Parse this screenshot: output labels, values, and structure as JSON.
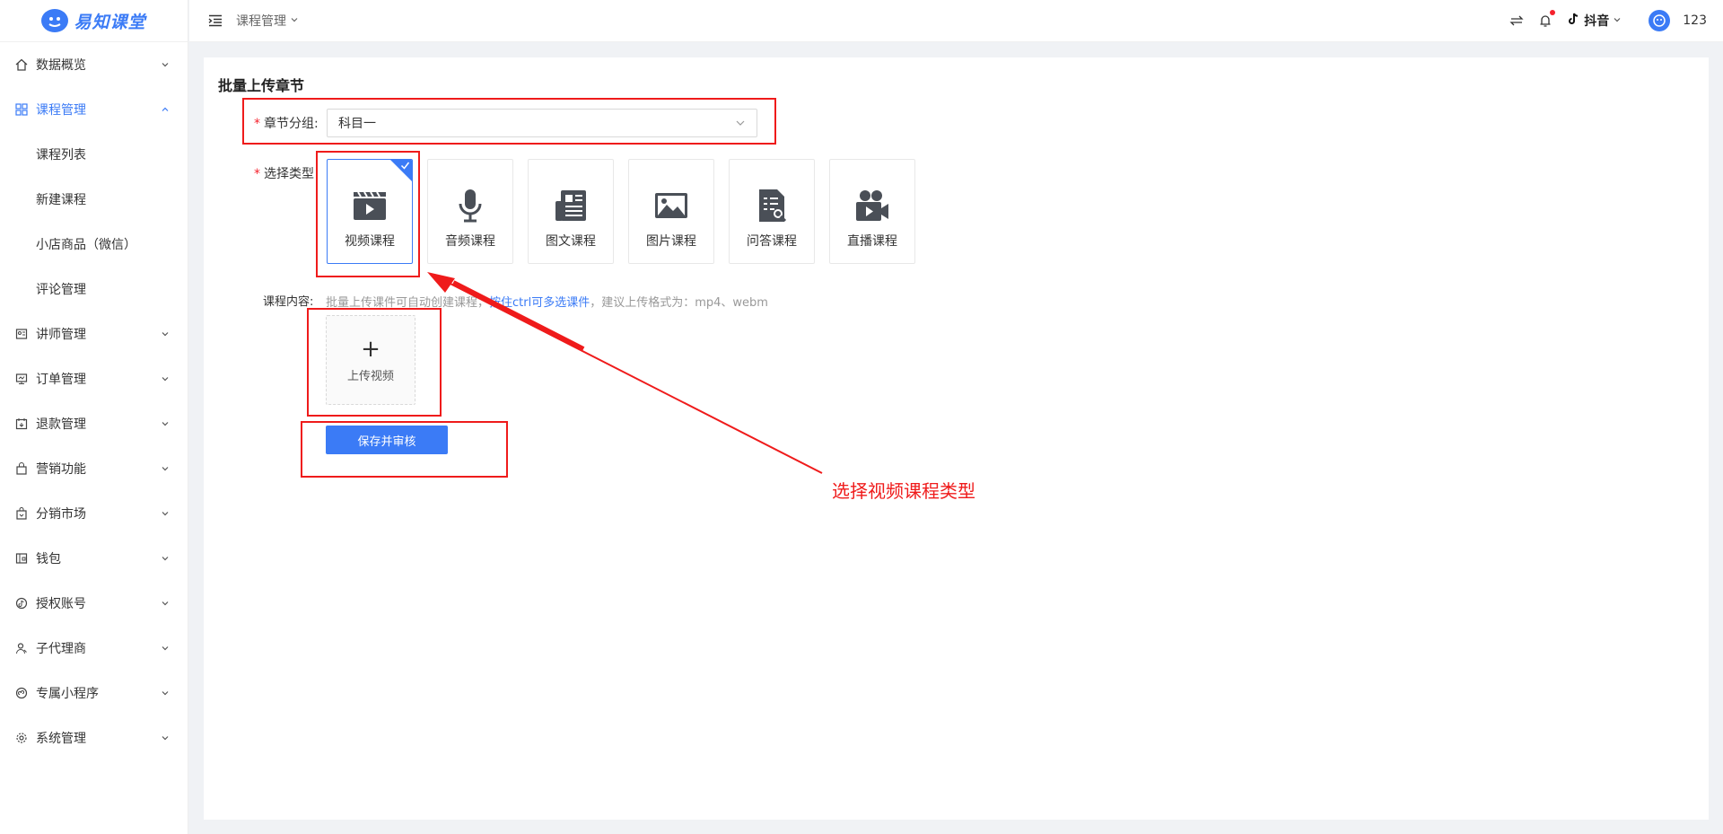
{
  "brand": {
    "name": "易知课堂"
  },
  "sidebar": {
    "items": [
      {
        "label": "数据概览",
        "icon": "home-icon",
        "active": false
      },
      {
        "label": "课程管理",
        "icon": "grid-icon",
        "active": true,
        "children": [
          {
            "label": "课程列表"
          },
          {
            "label": "新建课程"
          },
          {
            "label": "小店商品（微信）"
          },
          {
            "label": "评论管理"
          }
        ]
      },
      {
        "label": "讲师管理",
        "icon": "teacher-icon"
      },
      {
        "label": "订单管理",
        "icon": "order-icon"
      },
      {
        "label": "退款管理",
        "icon": "refund-icon"
      },
      {
        "label": "营销功能",
        "icon": "bag-icon"
      },
      {
        "label": "分销市场",
        "icon": "market-icon"
      },
      {
        "label": "钱包",
        "icon": "wallet-icon"
      },
      {
        "label": "授权账号",
        "icon": "tiktok-icon"
      },
      {
        "label": "子代理商",
        "icon": "agent-icon"
      },
      {
        "label": "专属小程序",
        "icon": "miniprogram-icon"
      },
      {
        "label": "系统管理",
        "icon": "gear-icon"
      }
    ]
  },
  "header": {
    "breadcrumb": "课程管理",
    "platform": "抖音",
    "username": "123"
  },
  "page": {
    "title": "批量上传章节",
    "group_label": "章节分组:",
    "group_value": "科目一",
    "type_label": "选择类型",
    "types": [
      {
        "label": "视频课程",
        "icon": "video-clapper-icon",
        "selected": true
      },
      {
        "label": "音频课程",
        "icon": "microphone-icon",
        "selected": false
      },
      {
        "label": "图文课程",
        "icon": "article-icon",
        "selected": false
      },
      {
        "label": "图片课程",
        "icon": "image-icon",
        "selected": false
      },
      {
        "label": "问答课程",
        "icon": "qa-document-icon",
        "selected": false
      },
      {
        "label": "直播课程",
        "icon": "live-camera-icon",
        "selected": false
      }
    ],
    "content_label": "课程内容:",
    "hint_prefix": "批量上传课件可自动创建课程，",
    "hint_link": "按住ctrl可多选课件",
    "hint_suffix": "，建议上传格式为：mp4、webm",
    "upload_label": "上传视频",
    "save_label": "保存并审核"
  },
  "annotation": {
    "text": "选择视频课程类型",
    "color": "#ef1b1b"
  },
  "colors": {
    "accent": "#3b7bf6",
    "annotation": "#ef1b1b"
  }
}
